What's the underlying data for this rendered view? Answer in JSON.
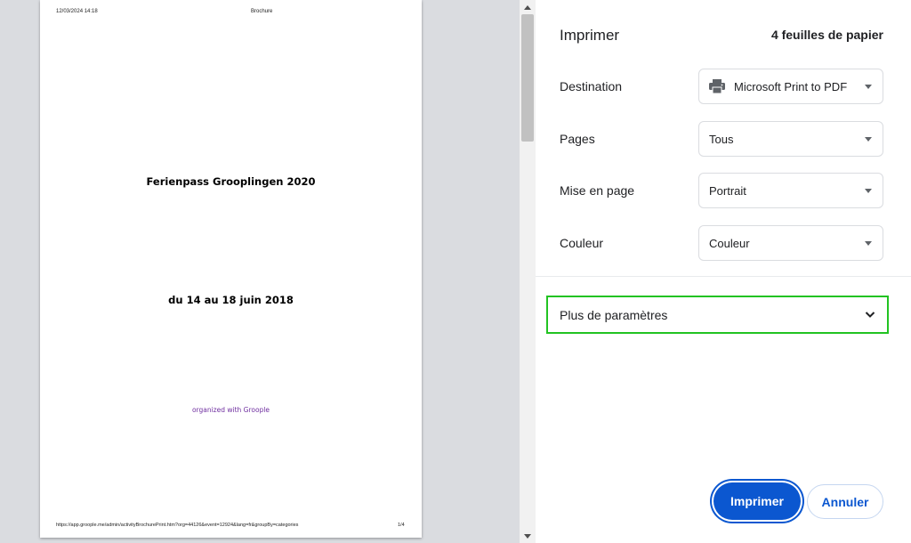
{
  "preview": {
    "header_datetime": "12/03/2024 14:18",
    "header_title": "Brochure",
    "title": "Ferienpass Grooplingen 2020",
    "dates": "du 14 au 18 juin 2018",
    "organizer": "organized with Groople",
    "footer_url": "https://app.groople.me/admin/activityBrochurePrint.htm?org=44126&event=12924&lang=fr&groupBy=categories",
    "page_number": "1/4",
    "organizer_color": "#7030a0"
  },
  "panel": {
    "title": "Imprimer",
    "sheet_count": "4 feuilles de papier",
    "rows": {
      "destination": {
        "label": "Destination",
        "value": "Microsoft Print to PDF",
        "icon": "printer-icon"
      },
      "pages": {
        "label": "Pages",
        "value": "Tous"
      },
      "layout": {
        "label": "Mise en page",
        "value": "Portrait"
      },
      "color": {
        "label": "Couleur",
        "value": "Couleur"
      }
    },
    "more_settings": "Plus de paramètres",
    "print_label": "Imprimer",
    "cancel_label": "Annuler",
    "accent_color": "#0b57d0",
    "highlight_color": "#22c322"
  }
}
